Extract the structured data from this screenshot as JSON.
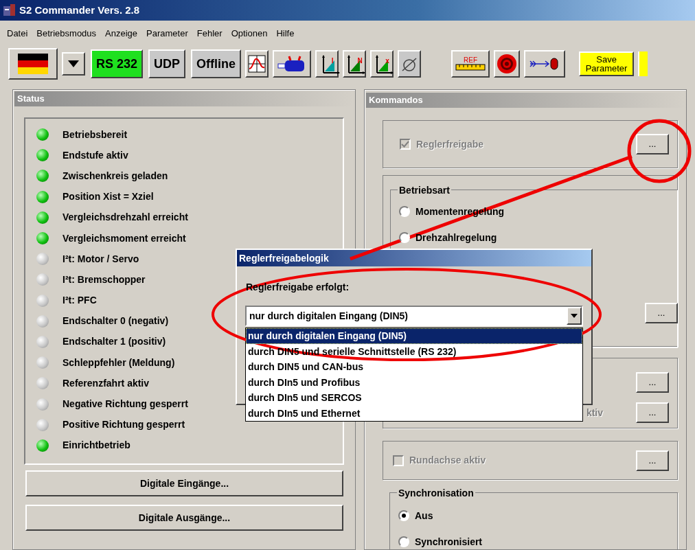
{
  "window": {
    "title": "S2 Commander Vers. 2.8"
  },
  "menu": [
    "Datei",
    "Betriebsmodus",
    "Anzeige",
    "Parameter",
    "Fehler",
    "Optionen",
    "Hilfe"
  ],
  "toolbar": [
    {
      "kind": "flag"
    },
    {
      "kind": "dropdown"
    },
    {
      "kind": "text",
      "label": "RS 232",
      "active": true
    },
    {
      "kind": "text",
      "label": "UDP",
      "active": false
    },
    {
      "kind": "text",
      "label": "Offline",
      "active": false
    },
    {
      "kind": "scope"
    },
    {
      "kind": "motor"
    },
    {
      "kind": "axis",
      "label": "I",
      "color": "#00a0a0"
    },
    {
      "kind": "axis",
      "label": "N",
      "color": "#008000"
    },
    {
      "kind": "axis",
      "label": "x",
      "color": "#00a000"
    },
    {
      "kind": "probe"
    },
    {
      "kind": "ruler",
      "label": "REF"
    },
    {
      "kind": "target"
    },
    {
      "kind": "jog"
    },
    {
      "kind": "save",
      "label": "Save Parameter"
    },
    {
      "kind": "partial"
    }
  ],
  "status": {
    "title": "Status",
    "items": [
      {
        "label": "Betriebsbereit",
        "on": true
      },
      {
        "label": "Endstufe aktiv",
        "on": true
      },
      {
        "label": "Zwischenkreis geladen",
        "on": true
      },
      {
        "label": "Position Xist = Xziel",
        "on": true
      },
      {
        "label": "Vergleichsdrehzahl erreicht",
        "on": true
      },
      {
        "label": "Vergleichsmoment erreicht",
        "on": true
      },
      {
        "label": "I²t: Motor / Servo",
        "on": false
      },
      {
        "label": "I²t: Bremschopper",
        "on": false
      },
      {
        "label": "I²t: PFC",
        "on": false
      },
      {
        "label": "Endschalter 0 (negativ)",
        "on": false
      },
      {
        "label": "Endschalter 1 (positiv)",
        "on": false
      },
      {
        "label": "Schleppfehler (Meldung)",
        "on": false
      },
      {
        "label": "Referenzfahrt aktiv",
        "on": false
      },
      {
        "label": "Negative Richtung gesperrt",
        "on": false
      },
      {
        "label": "Positive Richtung gesperrt",
        "on": false
      },
      {
        "label": "Einrichtbetrieb",
        "on": true
      }
    ],
    "buttons": [
      "Digitale Eingänge...",
      "Digitale Ausgänge..."
    ]
  },
  "commands": {
    "title": "Kommandos",
    "enable": {
      "label": "Reglerfreigabe",
      "checked": true,
      "disabled": true,
      "button": "..."
    },
    "mode": {
      "legend": "Betriebsart",
      "options": [
        {
          "label": "Momentenregelung",
          "selected": false
        },
        {
          "label": "Drehzahlregelung",
          "selected": false
        }
      ],
      "button": "..."
    },
    "hidden_row": {
      "label": "ktiv",
      "buttons": [
        "...",
        "..."
      ]
    },
    "round_axis": {
      "label": "Rundachse aktiv",
      "checked": false,
      "disabled": true,
      "button": "..."
    },
    "sync": {
      "legend": "Synchronisation",
      "options": [
        {
          "label": "Aus",
          "selected": true
        },
        {
          "label": "Synchronisiert",
          "selected": false
        }
      ]
    }
  },
  "dialog": {
    "title": "Reglerfreigabelogik",
    "label": "Reglerfreigabe erfolgt:",
    "value": "nur durch digitalen Eingang (DIN5)",
    "options": [
      {
        "label": "nur durch digitalen Eingang (DIN5)",
        "selected": true
      },
      {
        "label": "durch DIN5 und serielle Schnittstelle (RS 232)",
        "selected": false
      },
      {
        "label": "durch DIN5 und CAN-bus",
        "selected": false
      },
      {
        "label": "durch DIn5 und Profibus",
        "selected": false
      },
      {
        "label": "durch DIn5 und SERCOS",
        "selected": false
      },
      {
        "label": "durch DIn5 und Ethernet",
        "selected": false
      }
    ]
  }
}
